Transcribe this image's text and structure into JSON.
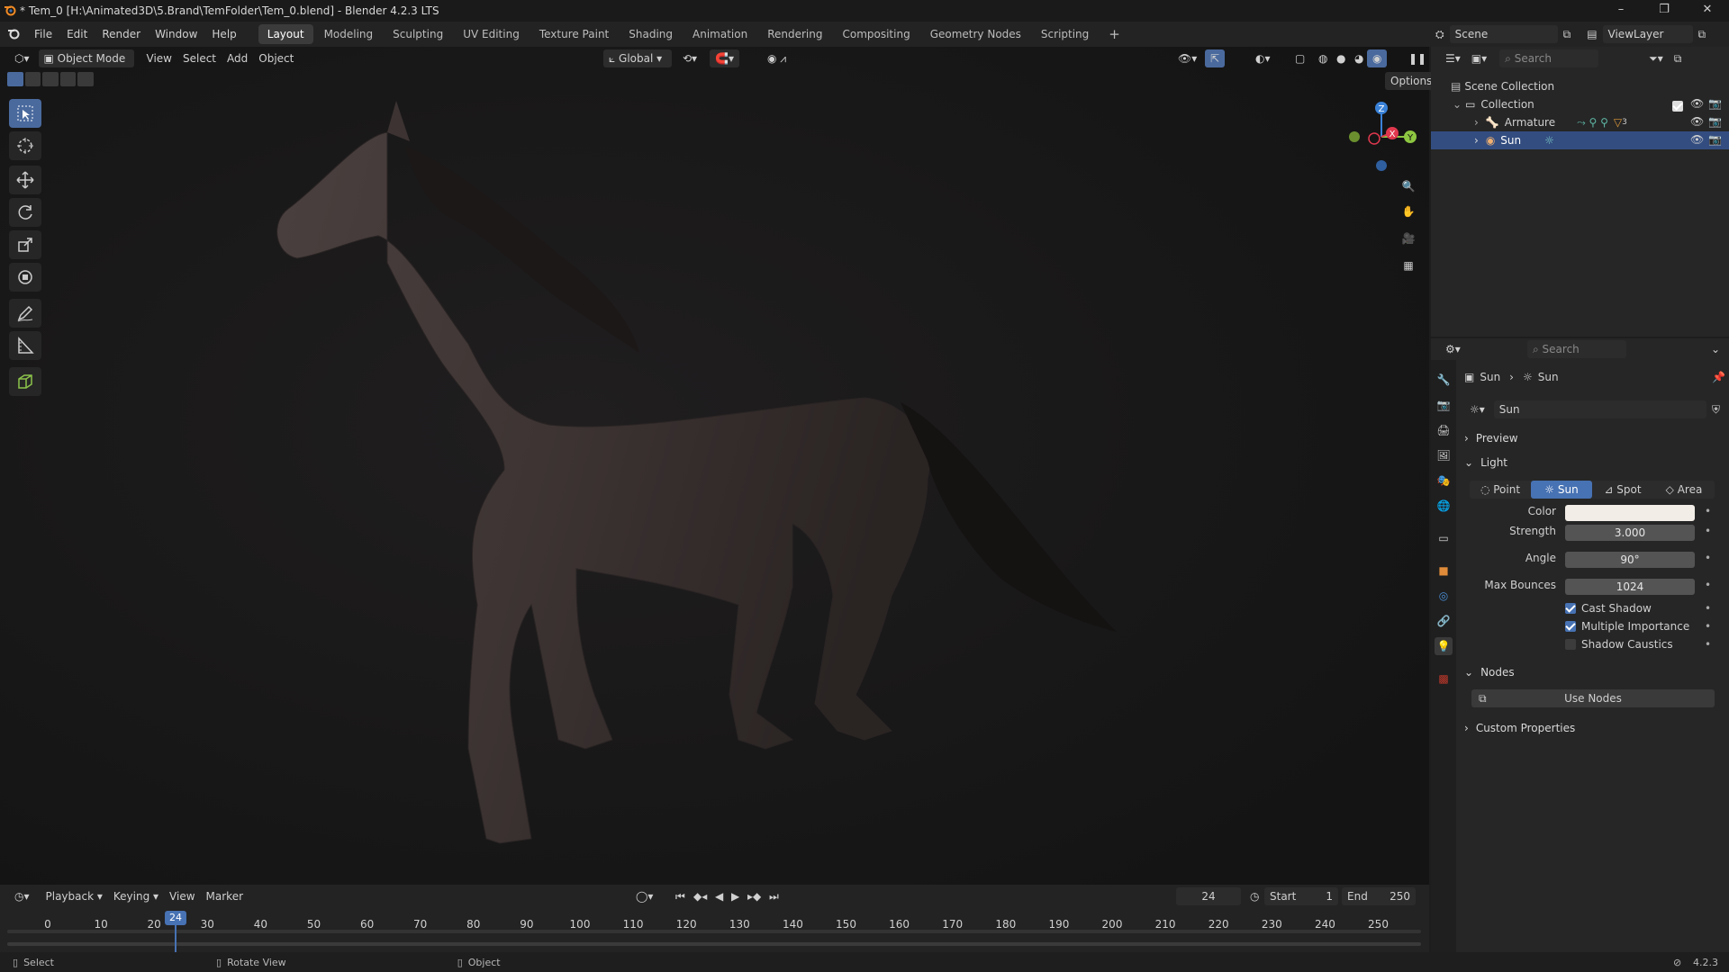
{
  "window": {
    "title": "* Tem_0 [H:\\Animated3D\\5.Brand\\TemFolder\\Tem_0.blend] - Blender 4.2.3 LTS"
  },
  "menu": {
    "items": [
      "File",
      "Edit",
      "Render",
      "Window",
      "Help"
    ]
  },
  "workspaces": [
    "Layout",
    "Modeling",
    "Sculpting",
    "UV Editing",
    "Texture Paint",
    "Shading",
    "Animation",
    "Rendering",
    "Compositing",
    "Geometry Nodes",
    "Scripting"
  ],
  "active_workspace": "Layout",
  "scene": {
    "label": "Scene",
    "view_layer": "ViewLayer"
  },
  "viewport_header": {
    "mode": "Object Mode",
    "menus": [
      "View",
      "Select",
      "Add",
      "Object"
    ],
    "transform_orientation": "Global",
    "options": "Options"
  },
  "gizmo": {
    "x": "X",
    "y": "Y",
    "z": "Z"
  },
  "outliner": {
    "search_placeholder": "Search",
    "rows": [
      {
        "label": "Scene Collection"
      },
      {
        "label": "Collection"
      },
      {
        "label": "Armature",
        "badge": "3"
      },
      {
        "label": "Sun"
      }
    ]
  },
  "properties": {
    "search_placeholder": "Search",
    "breadcrumb": [
      "Sun",
      "Sun"
    ],
    "datablock": "Sun",
    "sections": {
      "preview": "Preview",
      "light": "Light",
      "nodes": "Nodes",
      "custom": "Custom Properties"
    },
    "light_types": [
      "Point",
      "Sun",
      "Spot",
      "Area"
    ],
    "active_light_type": "Sun",
    "fields": {
      "color_label": "Color",
      "color_value": "#f2ede6",
      "strength_label": "Strength",
      "strength_value": "3.000",
      "angle_label": "Angle",
      "angle_value": "90°",
      "bounces_label": "Max Bounces",
      "bounces_value": "1024"
    },
    "checkboxes": [
      {
        "label": "Cast Shadow",
        "checked": true
      },
      {
        "label": "Multiple Importance",
        "checked": true
      },
      {
        "label": "Shadow Caustics",
        "checked": false
      }
    ],
    "use_nodes": "Use Nodes"
  },
  "timeline": {
    "menus": [
      "Playback",
      "Keying",
      "View",
      "Marker"
    ],
    "current_frame": "24",
    "start_label": "Start",
    "start_value": "1",
    "end_label": "End",
    "end_value": "250",
    "ticks": [
      "0",
      "10",
      "20",
      "30",
      "40",
      "50",
      "60",
      "70",
      "80",
      "90",
      "100",
      "110",
      "120",
      "130",
      "140",
      "150",
      "160",
      "170",
      "180",
      "190",
      "200",
      "210",
      "220",
      "230",
      "240",
      "250"
    ]
  },
  "status_bar": {
    "select": "Select",
    "rotate": "Rotate View",
    "object": "Object",
    "version": "4.2.3"
  },
  "colors": {
    "accent": "#4772b3",
    "selection": "#334d80",
    "x_axis": "#e0384e",
    "y_axis": "#8dc641",
    "z_axis": "#3a82d8"
  }
}
